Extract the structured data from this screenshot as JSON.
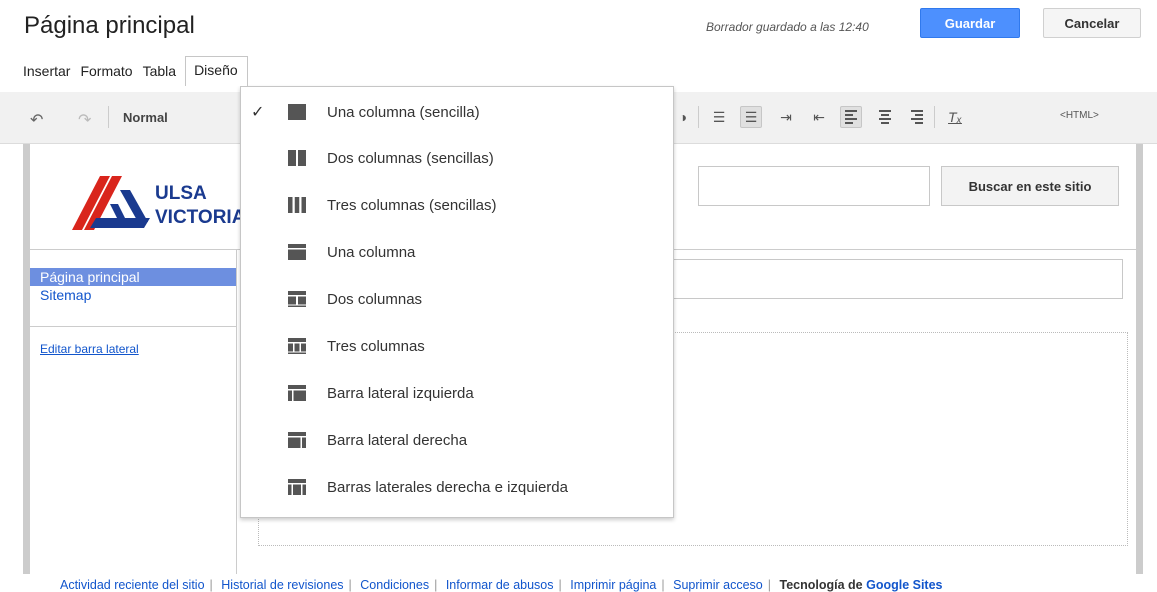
{
  "header": {
    "title": "Página principal",
    "draft_status": "Borrador guardado a las 12:40",
    "save_label": "Guardar",
    "cancel_label": "Cancelar"
  },
  "menubar": {
    "items": [
      "Insertar",
      "Formato",
      "Tabla",
      "Diseño"
    ],
    "active": "Diseño"
  },
  "toolbar": {
    "style_label": "Normal",
    "html_label": "<HTML>",
    "icons": [
      "undo-icon",
      "redo-icon",
      "numbered-list-icon",
      "bulleted-list-icon",
      "indent-icon",
      "outdent-icon",
      "align-left-icon",
      "align-center-icon",
      "align-right-icon",
      "clear-formatting-icon"
    ]
  },
  "site": {
    "logo_line1": "ULSA",
    "logo_line2": "VICTORIA",
    "search_button": "Buscar en este sitio",
    "sidebar": {
      "items": [
        "Página principal",
        "Sitemap"
      ],
      "edit_link": "Editar barra lateral"
    }
  },
  "layout_menu": {
    "items": [
      {
        "label": "Una columna (sencilla)",
        "icon": "one-column-simple-icon",
        "checked": true
      },
      {
        "label": "Dos columnas (sencillas)",
        "icon": "two-columns-simple-icon",
        "checked": false
      },
      {
        "label": "Tres columnas (sencillas)",
        "icon": "three-columns-simple-icon",
        "checked": false
      },
      {
        "label": "Una columna",
        "icon": "one-column-icon",
        "checked": false
      },
      {
        "label": "Dos columnas",
        "icon": "two-columns-icon",
        "checked": false
      },
      {
        "label": "Tres columnas",
        "icon": "three-columns-icon",
        "checked": false
      },
      {
        "label": "Barra lateral izquierda",
        "icon": "left-sidebar-icon",
        "checked": false
      },
      {
        "label": "Barra lateral derecha",
        "icon": "right-sidebar-icon",
        "checked": false
      },
      {
        "label": "Barras laterales derecha e izquierda",
        "icon": "both-sidebars-icon",
        "checked": false
      }
    ]
  },
  "footer": {
    "links": [
      "Actividad reciente del sitio",
      "Historial de revisiones",
      "Condiciones",
      "Informar de abusos",
      "Imprimir página",
      "Suprimir acceso"
    ],
    "powered_prefix": "Tecnología de",
    "powered_brand": "Google Sites"
  },
  "colors": {
    "primary_button": "#4d90fe",
    "link": "#1155cc",
    "sidebar_active": "#6d8fe0",
    "logo_red": "#d9251c",
    "logo_blue": "#1a3a8f"
  }
}
